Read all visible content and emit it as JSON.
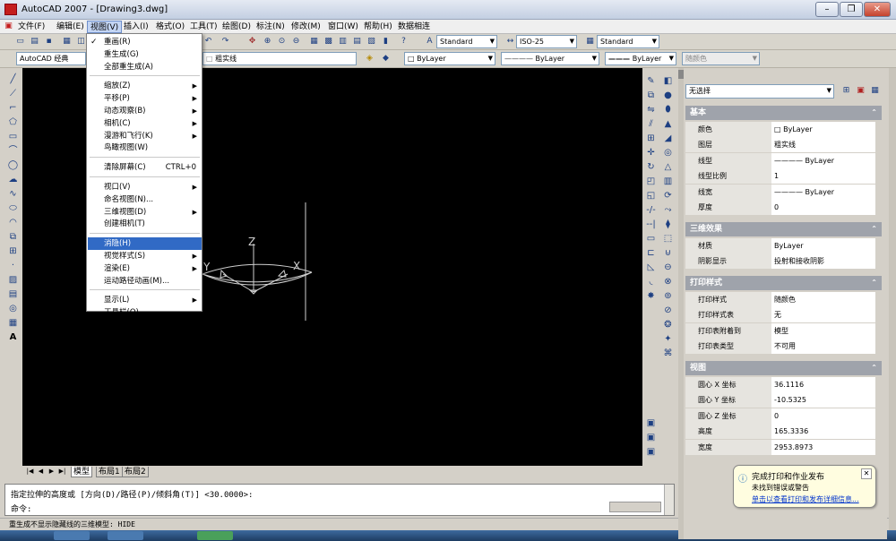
{
  "window": {
    "title": "AutoCAD 2007 - [Drawing3.dwg]",
    "min": "–",
    "restore": "❐",
    "close": "✕"
  },
  "menubar": [
    "文件(F)",
    "编辑(E)",
    "视图(V)",
    "插入(I)",
    "格式(O)",
    "工具(T)",
    "绘图(D)",
    "标注(N)",
    "修改(M)",
    "窗口(W)",
    "帮助(H)",
    "数据相连"
  ],
  "toolbar": {
    "text_style": "Standard",
    "dim_style": "ISO-25",
    "table_style": "Standard",
    "workspace": "AutoCAD 经典",
    "layer": "粗实线",
    "color": "ByLayer",
    "linetype": "ByLayer",
    "lineweight": "ByLayer",
    "plot_style": "随颜色"
  },
  "view_menu": {
    "items": [
      {
        "label": "重画(R)",
        "icon": "redraw-icon",
        "checked": true
      },
      {
        "label": "重生成(G)"
      },
      {
        "label": "全部重生成(A)"
      },
      {
        "sep": true
      },
      {
        "label": "缩放(Z)",
        "submenu": true
      },
      {
        "label": "平移(P)",
        "submenu": true
      },
      {
        "label": "动态观察(B)",
        "submenu": true
      },
      {
        "label": "相机(C)",
        "submenu": true
      },
      {
        "label": "漫游和飞行(K)",
        "submenu": true
      },
      {
        "label": "鸟瞰视图(W)"
      },
      {
        "sep": true
      },
      {
        "label": "清除屏幕(C)",
        "accel": "CTRL+0"
      },
      {
        "sep": true
      },
      {
        "label": "视口(V)",
        "submenu": true
      },
      {
        "label": "命名视图(N)..."
      },
      {
        "label": "三维视图(D)",
        "submenu": true
      },
      {
        "label": "创建相机(T)"
      },
      {
        "sep": true
      },
      {
        "label": "消隐(H)",
        "highlighted": true
      },
      {
        "label": "视觉样式(S)",
        "submenu": true
      },
      {
        "label": "渲染(E)",
        "submenu": true
      },
      {
        "label": "运动路径动画(M)..."
      },
      {
        "sep": true
      },
      {
        "label": "显示(L)",
        "submenu": true
      },
      {
        "label": "工具栏(O)..."
      }
    ]
  },
  "drawing": {
    "z_label": "Z",
    "x_label": "X",
    "y_label": "Y"
  },
  "layout_tabs": [
    "模型",
    "布局1",
    "布局2"
  ],
  "command": {
    "line1": "指定拉伸的高度或 [方向(D)/路径(P)/倾斜角(T)] <30.0000>:",
    "prompt": "命令:"
  },
  "status": {
    "text": "重生成不显示隐藏线的三维模型:  HIDE"
  },
  "properties": {
    "selection": "无选择",
    "sections": [
      {
        "title": "基本",
        "rows": [
          [
            "颜色",
            "□ ByLayer"
          ],
          [
            "图层",
            "粗实线"
          ],
          [
            "线型",
            "———— ByLayer"
          ],
          [
            "线型比例",
            "1"
          ],
          [
            "线宽",
            "———— ByLayer"
          ],
          [
            "厚度",
            "0"
          ]
        ]
      },
      {
        "title": "三维效果",
        "rows": [
          [
            "材质",
            "ByLayer"
          ],
          [
            "阴影显示",
            "投射和接收阴影"
          ]
        ]
      },
      {
        "title": "打印样式",
        "rows": [
          [
            "打印样式",
            "随颜色"
          ],
          [
            "打印样式表",
            "无"
          ],
          [
            "打印表附着到",
            "模型"
          ],
          [
            "打印表类型",
            "不可用"
          ]
        ]
      },
      {
        "title": "视图",
        "rows": [
          [
            "圆心 X 坐标",
            "36.1116"
          ],
          [
            "圆心 Y 坐标",
            "-10.5325"
          ],
          [
            "圆心 Z 坐标",
            "0"
          ],
          [
            "高度",
            "165.3336"
          ],
          [
            "宽度",
            "2953.8973"
          ]
        ]
      }
    ]
  },
  "balloon": {
    "title": "完成打印和作业发布",
    "line2": "未找到错误或警告",
    "link": "单击以查看打印和发布详细信息..."
  },
  "colors": {
    "canvas": "#000000",
    "menu_highlight": "#316ac5",
    "section_header": "#9fa3ab"
  }
}
